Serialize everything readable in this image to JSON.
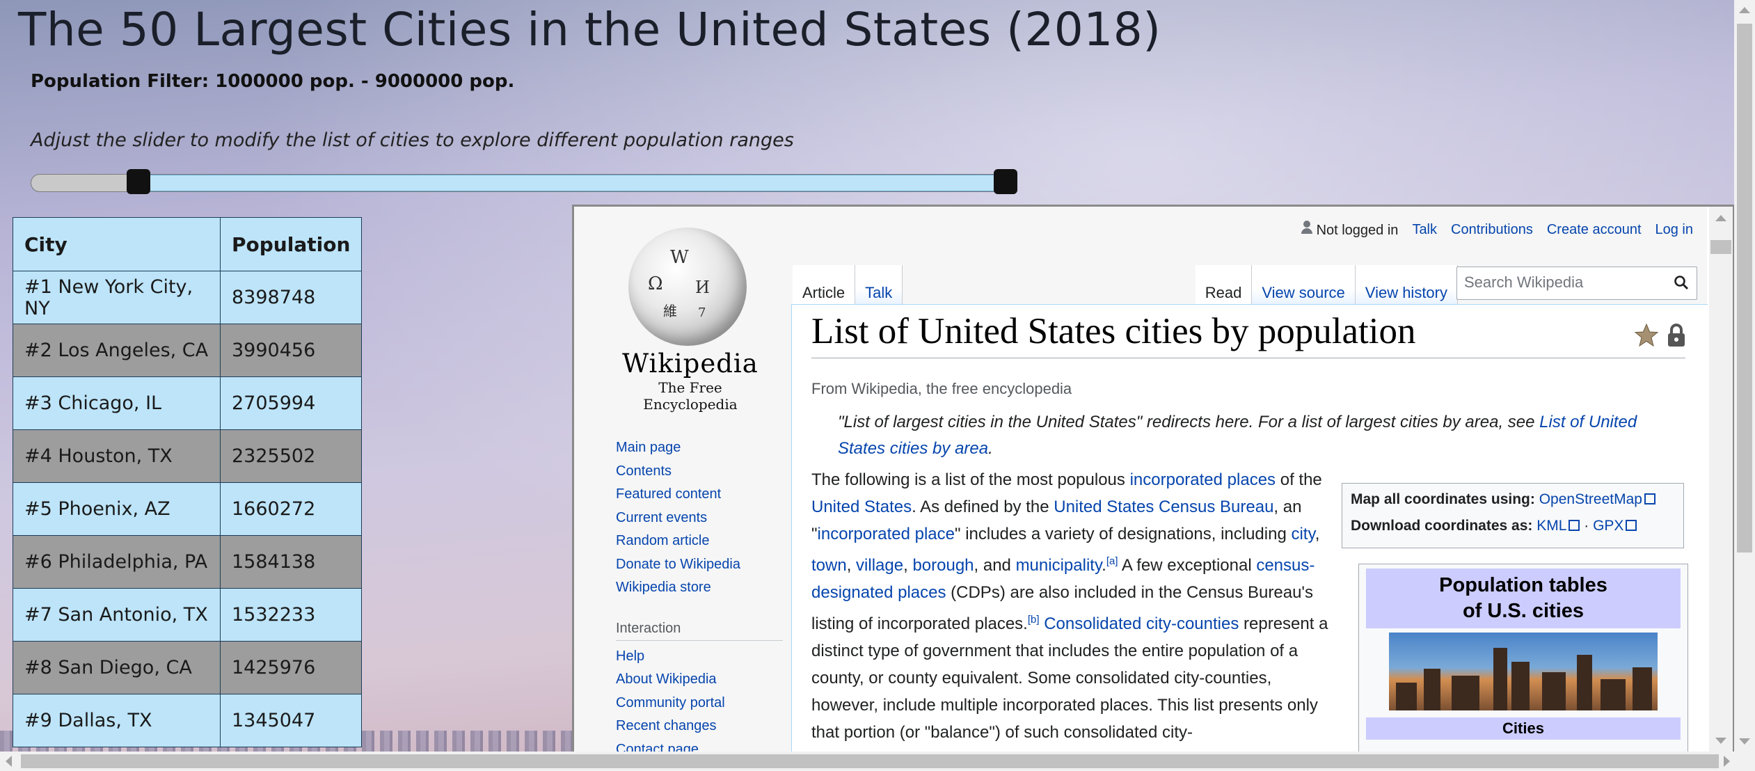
{
  "header": {
    "title": "The 50 Largest Cities in the United States (2018)",
    "filter_label": "Population Filter: 1000000 pop. - 9000000 pop.",
    "hint": "Adjust the slider to modify the list of cities to explore different population ranges"
  },
  "slider": {
    "min_value": 1000000,
    "max_value": 9000000
  },
  "table": {
    "headers": [
      "City",
      "Population"
    ],
    "rows": [
      [
        "#1 New York City, NY",
        "8398748"
      ],
      [
        "#2 Los Angeles, CA",
        "3990456"
      ],
      [
        "#3 Chicago, IL",
        "2705994"
      ],
      [
        "#4 Houston, TX",
        "2325502"
      ],
      [
        "#5 Phoenix, AZ",
        "1660272"
      ],
      [
        "#6 Philadelphia, PA",
        "1584138"
      ],
      [
        "#7 San Antonio, TX",
        "1532233"
      ],
      [
        "#8 San Diego, CA",
        "1425976"
      ],
      [
        "#9 Dallas, TX",
        "1345047"
      ]
    ]
  },
  "wiki": {
    "wordmark": "Wikipedia",
    "tagline": "The Free Encyclopedia",
    "personal": {
      "not_logged_in": "Not logged in",
      "talk": "Talk",
      "contributions": "Contributions",
      "create_account": "Create account",
      "log_in": "Log in"
    },
    "tabs_left": [
      "Article",
      "Talk"
    ],
    "tabs_right": [
      "Read",
      "View source",
      "View history"
    ],
    "search_placeholder": "Search Wikipedia",
    "nav": [
      "Main page",
      "Contents",
      "Featured content",
      "Current events",
      "Random article",
      "Donate to Wikipedia",
      "Wikipedia store"
    ],
    "interaction_heading": "Interaction",
    "interaction": [
      "Help",
      "About Wikipedia",
      "Community portal",
      "Recent changes",
      "Contact page"
    ],
    "page_title": "List of United States cities by population",
    "from_line": "From Wikipedia, the free encyclopedia",
    "hatnote_text": "\"List of largest cities in the United States\" redirects here. For a list of largest cities by area, see ",
    "hatnote_link": "List of United States cities by area",
    "hatnote_end": ".",
    "body": {
      "p1": "The following is a list of the most populous ",
      "l1": "incorporated places",
      "p2": " of the ",
      "l2": "United States",
      "p3": ". As defined by the ",
      "l3": "United States Census Bureau",
      "p4": ", an \"",
      "l4": "incorporated place",
      "p5": "\" includes a variety of designations, including ",
      "l5": "city",
      "p6": ", ",
      "l6": "town",
      "p7": ", ",
      "l7": "village",
      "p8": ", ",
      "l8": "borough",
      "p9": ", and ",
      "l9": "municipality",
      "p10": ".",
      "note_a": "[a]",
      "p11": " A few exceptional ",
      "l10": "census-designated places",
      "p12": " (CDPs) are also included in the Census Bureau's listing of incorporated places.",
      "note_b": "[b]",
      "p13": " ",
      "l11": "Consolidated city-counties",
      "p14": " represent a distinct type of government that includes the entire population of a county, or county equivalent. Some consolidated city-counties, however, include multiple incorporated places. This list presents only that portion (or \"balance\") of such consolidated city-"
    },
    "coords": {
      "map_label": "Map all coordinates using:",
      "map_link": "OpenStreetMap",
      "download_label": "Download coordinates as:",
      "kml": "KML",
      "sep": "·",
      "gpx": "GPX"
    },
    "pop_box": {
      "title_line1": "Population tables",
      "title_line2": "of U.S. cities",
      "caption": "Cities"
    }
  },
  "colors": {
    "table_blue": "#bde4f9",
    "table_gray": "#9d9d9d",
    "link": "#0645ad"
  }
}
